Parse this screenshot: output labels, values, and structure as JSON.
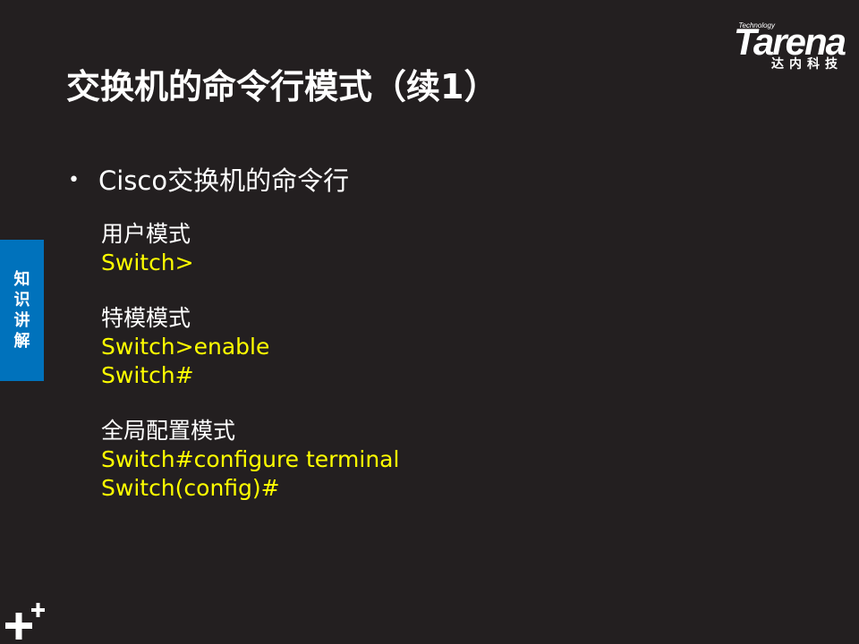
{
  "logo": {
    "technology": "Technology",
    "wordmark": "Tarena",
    "subtitle": "达内科技"
  },
  "title": "交换机的命令行模式（续1）",
  "bullet": "Cisco交换机的命令行",
  "sections": [
    {
      "label": "用户模式",
      "commands": [
        "Switch>"
      ]
    },
    {
      "label": "特模模式",
      "commands": [
        "Switch>enable",
        "Switch#"
      ]
    },
    {
      "label": "全局配置模式",
      "commands": [
        "Switch#configure terminal",
        "Switch(config)#"
      ]
    }
  ],
  "side_tab": [
    "知",
    "识",
    "讲",
    "解"
  ],
  "colors": {
    "background": "#231f20",
    "command": "#ffff00",
    "side_tab": "#0072bc"
  }
}
